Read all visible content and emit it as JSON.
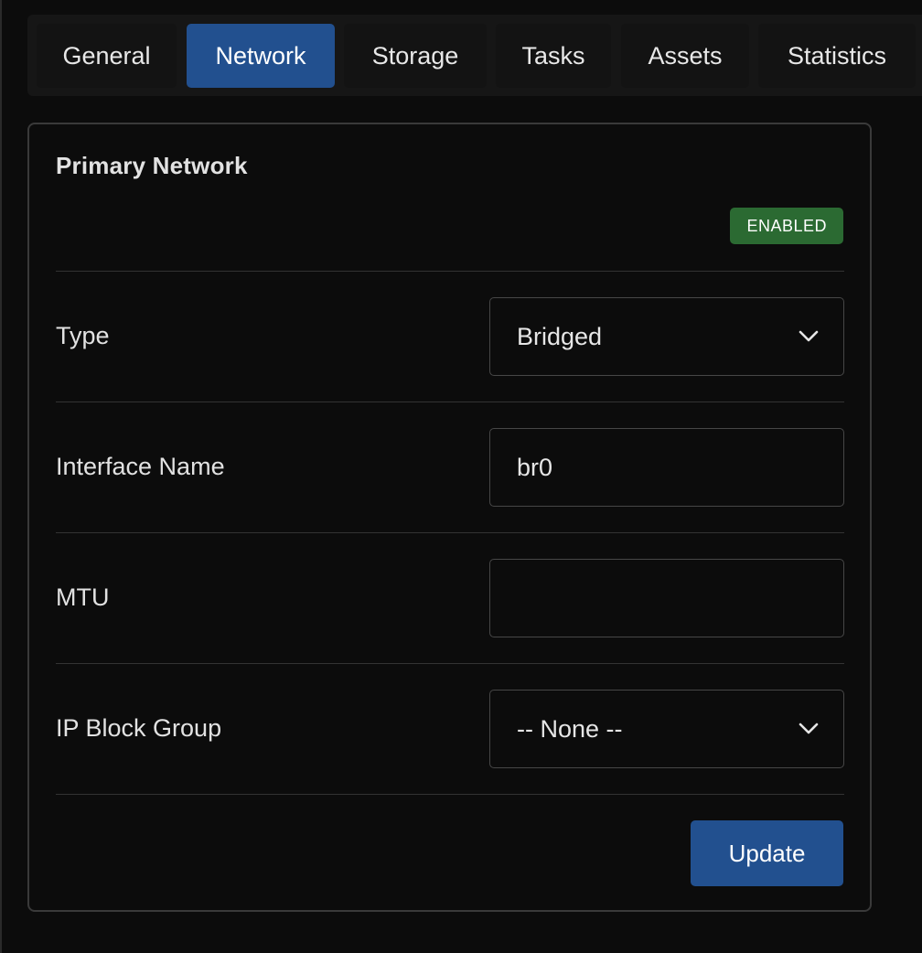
{
  "tabs": [
    {
      "label": "General",
      "active": false
    },
    {
      "label": "Network",
      "active": true
    },
    {
      "label": "Storage",
      "active": false
    },
    {
      "label": "Tasks",
      "active": false
    },
    {
      "label": "Assets",
      "active": false
    },
    {
      "label": "Statistics",
      "active": false
    }
  ],
  "card": {
    "title": "Primary Network",
    "status_badge": "ENABLED",
    "fields": {
      "type": {
        "label": "Type",
        "value": "Bridged",
        "icon": "chevron-down-icon"
      },
      "interface_name": {
        "label": "Interface Name",
        "value": "br0"
      },
      "mtu": {
        "label": "MTU",
        "value": ""
      },
      "ip_block_group": {
        "label": "IP Block Group",
        "value": "-- None --",
        "icon": "chevron-down-icon"
      }
    },
    "update_label": "Update"
  },
  "colors": {
    "accent": "#22508f",
    "success": "#2b6a32",
    "background": "#0c0c0c"
  }
}
